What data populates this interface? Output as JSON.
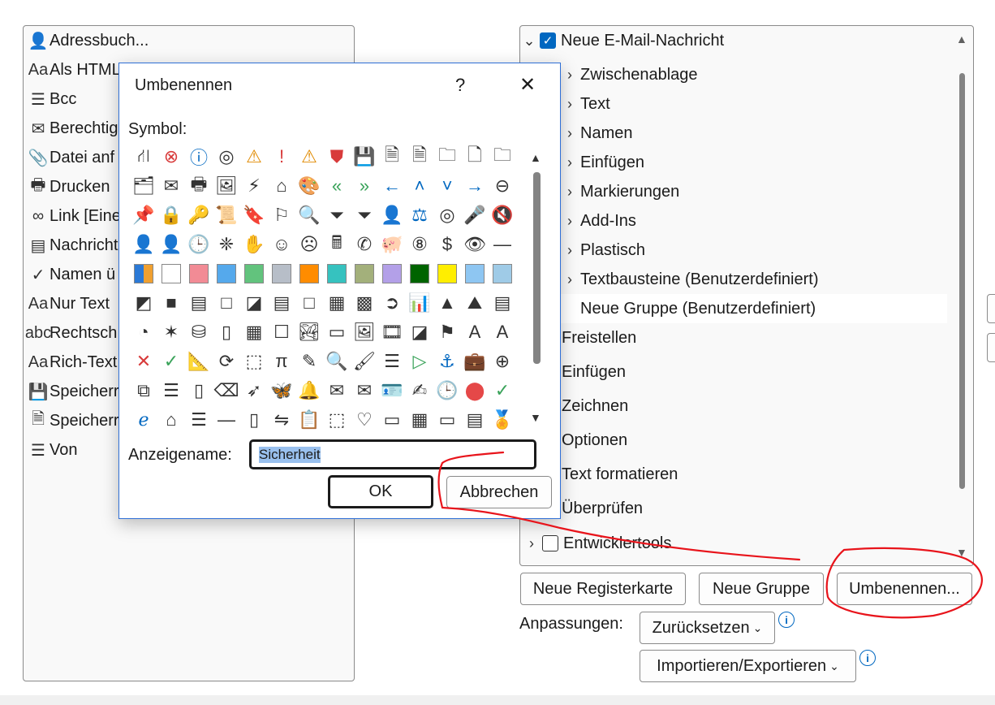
{
  "left_list": {
    "items": [
      {
        "icon": "address-book-icon",
        "glyph": "👤",
        "label": "Adressbuch..."
      },
      {
        "icon": "html-format-icon",
        "glyph": "Aa",
        "label": "Als HTML"
      },
      {
        "icon": "bcc-icon",
        "glyph": "☰",
        "label": "Bcc"
      },
      {
        "icon": "permission-icon",
        "glyph": "✉",
        "label": "Berechtig"
      },
      {
        "icon": "attach-file-icon",
        "glyph": "📎",
        "label": "Datei anf"
      },
      {
        "icon": "print-icon",
        "glyph": "🖶",
        "label": "Drucken"
      },
      {
        "icon": "link-icon",
        "glyph": "∞",
        "label": "Link [Eine"
      },
      {
        "icon": "message-icon",
        "glyph": "▤",
        "label": "Nachricht"
      },
      {
        "icon": "check-names-icon",
        "glyph": "✓",
        "label": "Namen ü"
      },
      {
        "icon": "plain-text-icon",
        "glyph": "Aa",
        "label": "Nur Text"
      },
      {
        "icon": "spelling-icon",
        "glyph": "abc",
        "label": "Rechtsch"
      },
      {
        "icon": "rich-text-icon",
        "glyph": "Aa",
        "label": "Rich-Text"
      },
      {
        "icon": "save-icon",
        "glyph": "💾",
        "label": "Speicherr"
      },
      {
        "icon": "save-as-icon",
        "glyph": "🗎",
        "label": "Speicherr"
      },
      {
        "icon": "from-icon",
        "glyph": "☰",
        "label": "Von"
      }
    ]
  },
  "right_tree": {
    "root": {
      "label": "Neue E-Mail-Nachricht",
      "checked": true,
      "expanded": true
    },
    "groups": [
      {
        "label": "Zwischenablage"
      },
      {
        "label": "Text"
      },
      {
        "label": "Namen"
      },
      {
        "label": "Einfügen"
      },
      {
        "label": "Markierungen"
      },
      {
        "label": "Add-Ins"
      },
      {
        "label": "Plastisch"
      },
      {
        "label": "Textbausteine (Benutzerdefiniert)"
      }
    ],
    "selected_group": {
      "label": "Neue Gruppe (Benutzerdefiniert)"
    },
    "tabs": [
      {
        "label": "Freistellen"
      },
      {
        "label": "Einfügen"
      },
      {
        "label": "Zeichnen"
      },
      {
        "label": "Optionen"
      },
      {
        "label": "Text formatieren"
      },
      {
        "label": "Überprüfen"
      }
    ],
    "last": {
      "label": "Entwicklertools",
      "checked": false
    }
  },
  "buttons": {
    "new_tab": "Neue Registerkarte",
    "new_group": "Neue Gruppe",
    "rename": "Umbenennen...",
    "customizations_label": "Anpassungen:",
    "reset": "Zurücksetzen",
    "import_export": "Importieren/Exportieren"
  },
  "dialog": {
    "title": "Umbenennen",
    "help": "?",
    "close": "✕",
    "symbol_label": "Symbol:",
    "display_name_label": "Anzeigename:",
    "display_name_value": "Sicherheit",
    "ok": "OK",
    "cancel": "Abbrechen",
    "symbols": [
      "⛙",
      "⊗",
      "ⓘ",
      "◎",
      "⚠",
      "!",
      "⚠",
      "⛊",
      "💾",
      "🗎",
      "🗎",
      "🗀",
      "🗋",
      "🗀",
      "🗂",
      "✉",
      "🖶",
      "🖼",
      "⚡",
      "⌂",
      "🎨",
      "«",
      "»",
      "←",
      "˄",
      "˅",
      "→",
      "⊖",
      "📌",
      "🔒",
      "🔑",
      "📜",
      "🔖",
      "⚐",
      "🔍",
      "⏷",
      "⏷",
      "👤",
      "⚖",
      "◎",
      "🎤",
      "🔇",
      "👤",
      "👤",
      "🕒",
      "❈",
      "✋",
      "☺",
      "☹",
      "🖩",
      "✆",
      "🐖",
      "⑧",
      "$",
      "👁",
      "—",
      "#1",
      "#2",
      "#3",
      "#4",
      "#5",
      "#6",
      "#7",
      "#8",
      "#9",
      "#10",
      "#11",
      "#12",
      "#13",
      "#14",
      "◩",
      "■",
      "▤",
      "□",
      "◪",
      "▤",
      "□",
      "▦",
      "▩",
      "➲",
      "📊",
      "▲",
      "⛰",
      "▤",
      "◔",
      "✶",
      "⛁",
      "▯",
      "▦",
      "☐",
      "🏞",
      "▭",
      "🖼",
      "🎞",
      "◪",
      "⚑",
      "A",
      "A",
      "✕",
      "✓",
      "📐",
      "⟳",
      "⬚",
      "π",
      "✎",
      "🔍",
      "🖌",
      "☰",
      "▷",
      "⚓",
      "💼",
      "⊕",
      "⧉",
      "☰",
      "▯",
      "⌫",
      "➶",
      "🦋",
      "🔔",
      "✉",
      "✉",
      "🪪",
      "✍",
      "🕒",
      "⬤",
      "✓",
      "ℯ",
      "⌂",
      "☰",
      "—",
      "▯",
      "⇋",
      "📋",
      "⬚",
      "♡",
      "▭",
      "▦",
      "▭",
      "▤",
      "🏅"
    ],
    "swatches": [
      "#multi",
      "#ffffff",
      "#f28b95",
      "#55a9ec",
      "#62c37d",
      "#b7bec8",
      "#ff8c00",
      "#36c2bf",
      "#a3b07b",
      "#b3a0e8",
      "#006400",
      "#ffee00",
      "#8ec6f2",
      "#9fcbe7"
    ]
  }
}
